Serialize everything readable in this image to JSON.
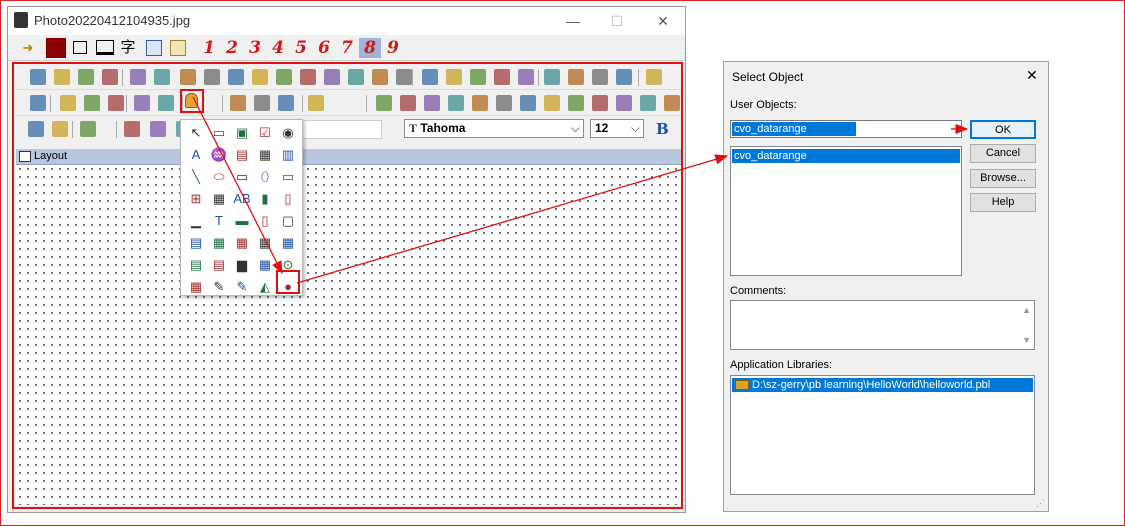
{
  "window": {
    "title": "Photo20220412104935.jpg",
    "numbers": [
      "1",
      "2",
      "3",
      "4",
      "5",
      "6",
      "7",
      "8",
      "9"
    ],
    "char_label": "字",
    "layout_label": "Layout",
    "font_name": "Tahoma",
    "font_size": "12",
    "bold_label": "B",
    "close_glyph": "✕"
  },
  "dialog": {
    "title": "Select Object",
    "user_objects_label": "User Objects:",
    "user_object_input": "cvo_datarange",
    "user_object_list": [
      "cvo_datarange"
    ],
    "ok_label": "OK",
    "cancel_label": "Cancel",
    "browse_label": "Browse...",
    "help_label": "Help",
    "comments_label": "Comments:",
    "libraries_label": "Application Libraries:",
    "library_path": "D:\\sz-gerry\\pb learning\\HelloWorld\\helloworld.pbl",
    "close_glyph": "✕"
  },
  "palette": {
    "text_tool": "A",
    "label_ab": "AB"
  },
  "colors": {
    "highlight": "#e01010",
    "selection": "#0078d7",
    "number_red": "#d01818"
  }
}
